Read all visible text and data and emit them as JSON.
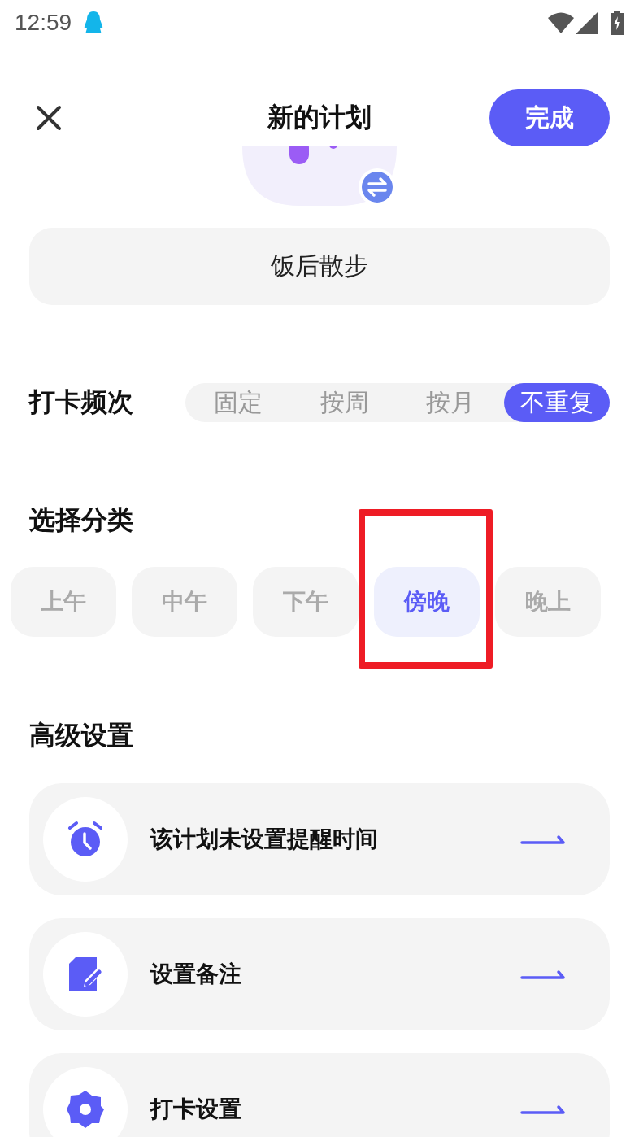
{
  "status_bar": {
    "time": "12:59"
  },
  "header": {
    "title": "新的计划",
    "done_button": "完成"
  },
  "plan_name": {
    "value": "饭后散步"
  },
  "frequency": {
    "label": "打卡频次",
    "options": [
      {
        "label": "固定",
        "selected": false
      },
      {
        "label": "按周",
        "selected": false
      },
      {
        "label": "按月",
        "selected": false
      },
      {
        "label": "不重复",
        "selected": true
      }
    ]
  },
  "category": {
    "label": "选择分类",
    "options": [
      {
        "label": "上午",
        "selected": false,
        "highlighted": false
      },
      {
        "label": "中午",
        "selected": false,
        "highlighted": false
      },
      {
        "label": "下午",
        "selected": false,
        "highlighted": false
      },
      {
        "label": "傍晚",
        "selected": true,
        "highlighted": true
      },
      {
        "label": "晚上",
        "selected": false,
        "highlighted": false
      }
    ]
  },
  "advanced": {
    "title": "高级设置",
    "items": [
      {
        "kind": "alarm",
        "label": "该计划未设置提醒时间"
      },
      {
        "kind": "note",
        "label": "设置备注"
      },
      {
        "kind": "gear",
        "label": "打卡设置"
      }
    ]
  }
}
